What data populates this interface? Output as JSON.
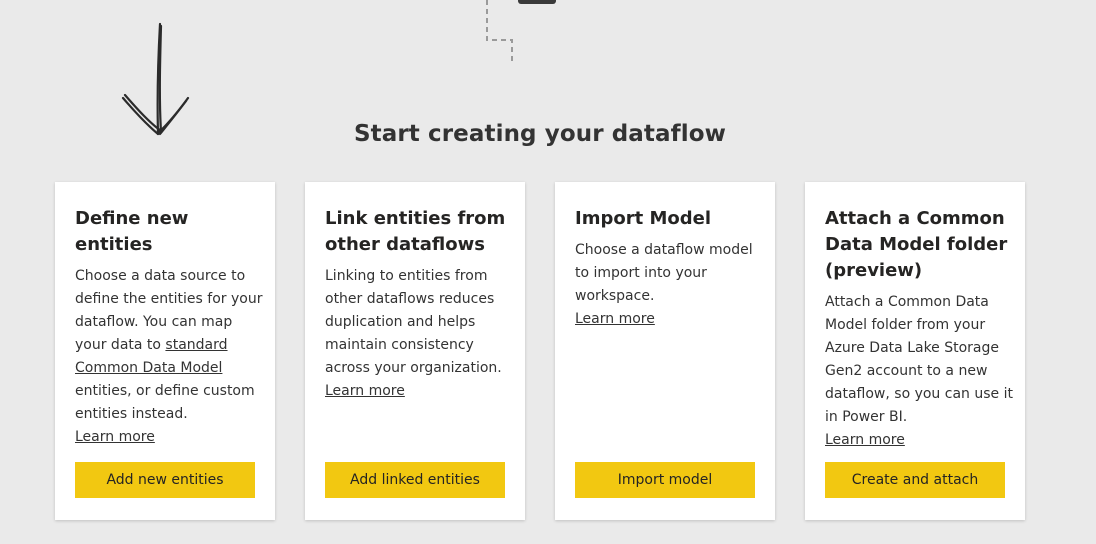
{
  "page": {
    "title": "Start creating your dataflow"
  },
  "cards": [
    {
      "title": "Define new entities",
      "desc_intro": "Choose a data source to define the entities for your dataflow. You can map your data to ",
      "desc_link": "standard Common Data Model",
      "desc_outro": " entities, or define custom entities instead.",
      "learn_more": "Learn more",
      "button": "Add new entities"
    },
    {
      "title": "Link entities from other dataflows",
      "desc": "Linking to entities from other dataflows reduces duplication and helps maintain consistency across your organization.",
      "learn_more": "Learn more",
      "button": "Add linked entities"
    },
    {
      "title": "Import Model",
      "desc": "Choose a dataflow model to import into your workspace.",
      "learn_more": "Learn more",
      "button": "Import model"
    },
    {
      "title": "Attach a Common Data Model folder (preview)",
      "desc": "Attach a Common Data Model folder from your Azure Data Lake Storage Gen2 account to a new dataflow, so you can use it in Power BI.",
      "learn_more": "Learn more",
      "button": "Create and attach"
    }
  ],
  "colors": {
    "background": "#eaeaea",
    "card": "#ffffff",
    "button": "#f2c811",
    "text": "#252423"
  }
}
